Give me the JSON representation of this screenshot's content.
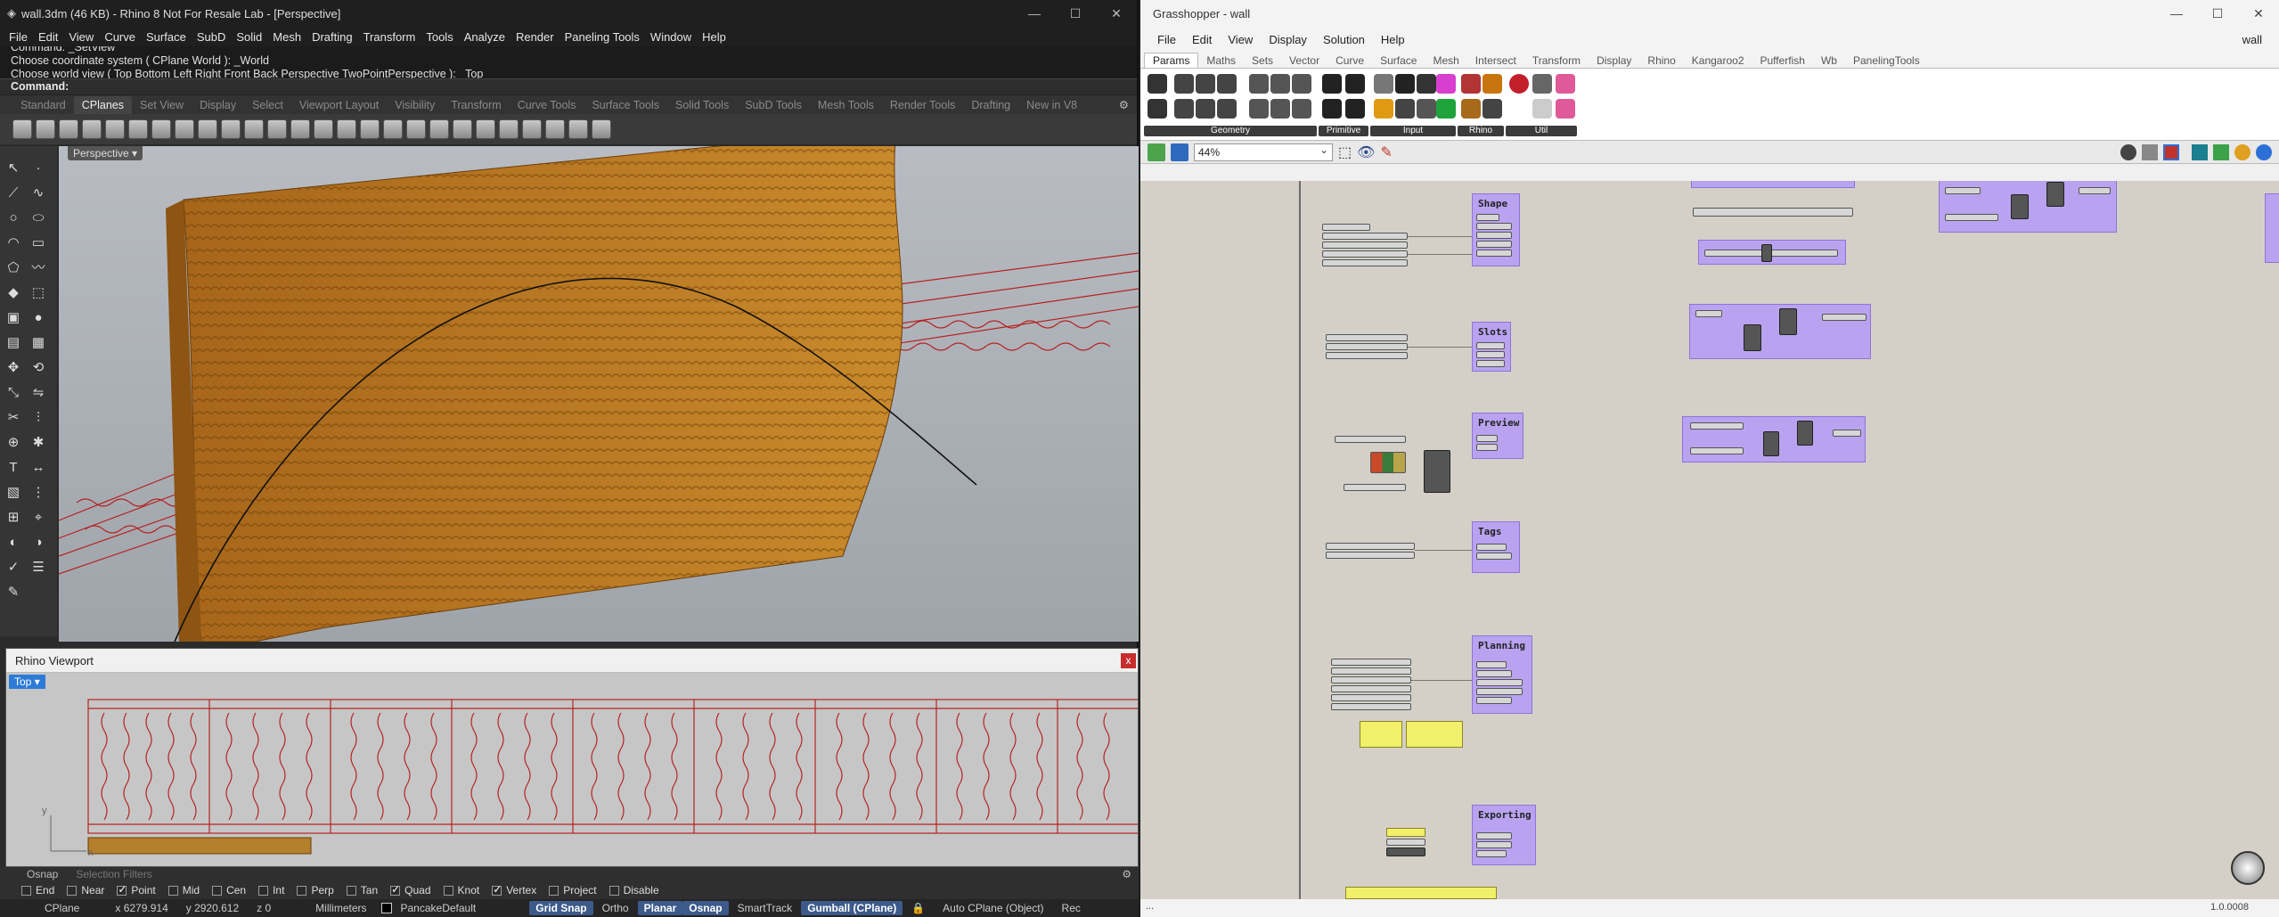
{
  "rhino": {
    "title": "wall.3dm (46 KB) - Rhino 8 Not For Resale Lab - [Perspective]",
    "menu": [
      "File",
      "Edit",
      "View",
      "Curve",
      "Surface",
      "SubD",
      "Solid",
      "Mesh",
      "Drafting",
      "Transform",
      "Tools",
      "Analyze",
      "Render",
      "Paneling Tools",
      "Window",
      "Help"
    ],
    "command_history": [
      "Command: _SetView",
      "Choose coordinate system ( CPlane  World ): _World",
      "Choose world view ( Top  Bottom  Left  Right  Front  Back  Perspective  TwoPointPerspective ): _Top"
    ],
    "command_prompt": "Command:",
    "toolbar_tabs": [
      "Standard",
      "CPlanes",
      "Set View",
      "Display",
      "Select",
      "Viewport Layout",
      "Visibility",
      "Transform",
      "Curve Tools",
      "Surface Tools",
      "Solid Tools",
      "SubD Tools",
      "Mesh Tools",
      "Render Tools",
      "Drafting",
      "New in V8"
    ],
    "active_tab": "CPlanes",
    "viewport_label": "Perspective",
    "floating_viewport": {
      "title": "Rhino Viewport",
      "close": "x",
      "view_label": "Top"
    },
    "panel_tabs": [
      "Osnap",
      "Selection Filters"
    ],
    "osnap": [
      {
        "label": "End",
        "on": false
      },
      {
        "label": "Near",
        "on": false
      },
      {
        "label": "Point",
        "on": true
      },
      {
        "label": "Mid",
        "on": false
      },
      {
        "label": "Cen",
        "on": false
      },
      {
        "label": "Int",
        "on": false
      },
      {
        "label": "Perp",
        "on": false
      },
      {
        "label": "Tan",
        "on": false
      },
      {
        "label": "Quad",
        "on": true
      },
      {
        "label": "Knot",
        "on": false
      },
      {
        "label": "Vertex",
        "on": true
      },
      {
        "label": "Project",
        "on": false
      },
      {
        "label": "Disable",
        "on": false
      }
    ],
    "status": {
      "cplane": "CPlane",
      "x": "x 6279.914",
      "y": "y 2920.612",
      "z": "z 0",
      "units": "Millimeters",
      "layer": "PancakeDefault",
      "grid_snap": "Grid Snap",
      "ortho": "Ortho",
      "planar": "Planar",
      "osnap": "Osnap",
      "smarttrack": "SmartTrack",
      "gumball": "Gumball (CPlane)",
      "auto_cplane": "Auto CPlane (Object)",
      "record": "Rec"
    }
  },
  "grasshopper": {
    "title": "Grasshopper - wall",
    "menu": [
      "File",
      "Edit",
      "View",
      "Display",
      "Solution",
      "Help"
    ],
    "doc_name": "wall",
    "tabs": [
      "Params",
      "Maths",
      "Sets",
      "Vector",
      "Curve",
      "Surface",
      "Mesh",
      "Intersect",
      "Transform",
      "Display",
      "Rhino",
      "Kangaroo2",
      "Pufferfish",
      "Wb",
      "PanelingTools"
    ],
    "active_tab": "Params",
    "ribbon_groups": [
      "Geometry",
      "Primitive",
      "Input",
      "Rhino",
      "Util"
    ],
    "zoom": "44%",
    "groups": [
      "Shape",
      "Slots",
      "Preview",
      "Tags",
      "Planning",
      "Exporting"
    ],
    "version": "1.0.0008"
  }
}
